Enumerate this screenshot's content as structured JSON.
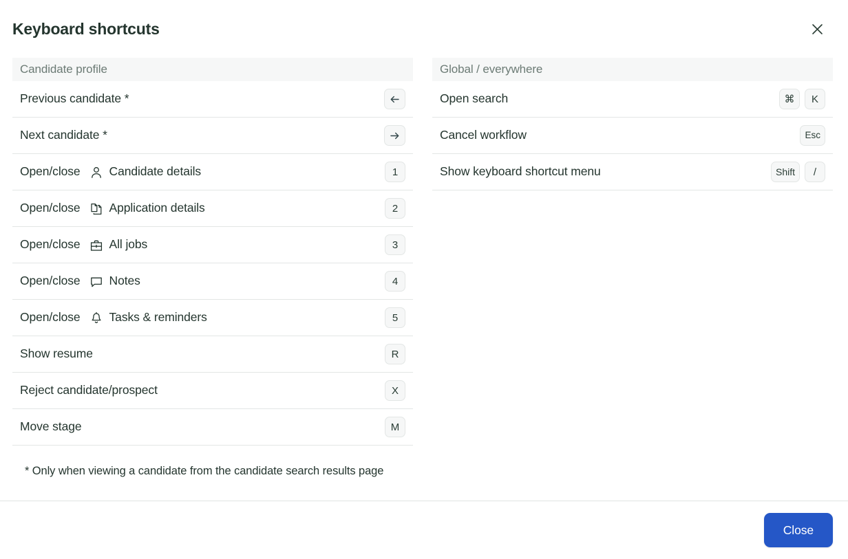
{
  "modal": {
    "title": "Keyboard shortcuts",
    "close_icon": "close-icon",
    "footnote": "* Only when viewing a candidate from the candidate search results page",
    "close_button_label": "Close",
    "accent_color": "#2557c7",
    "text_color": "#24352e",
    "muted_color": "#6c7b75",
    "section_bg": "#f6f7f7",
    "key_bg": "#f6f7f7",
    "key_border": "#e3e6e5",
    "divider_color": "#e3e6e5"
  },
  "columns": [
    {
      "heading": "Candidate profile",
      "rows": [
        {
          "prefix": "Previous candidate *",
          "icon": null,
          "suffix": null,
          "keys": [
            {
              "glyph": "arrow-left",
              "label": "←",
              "type": "icon"
            }
          ]
        },
        {
          "prefix": "Next candidate *",
          "icon": null,
          "suffix": null,
          "keys": [
            {
              "glyph": "arrow-right",
              "label": "→",
              "type": "icon"
            }
          ]
        },
        {
          "prefix": "Open/close",
          "icon": "person-icon",
          "suffix": "Candidate details",
          "keys": [
            {
              "label": "1",
              "type": "text"
            }
          ]
        },
        {
          "prefix": "Open/close",
          "icon": "copy-documents-icon",
          "suffix": "Application details",
          "keys": [
            {
              "label": "2",
              "type": "text"
            }
          ]
        },
        {
          "prefix": "Open/close",
          "icon": "briefcase-icon",
          "suffix": "All jobs",
          "keys": [
            {
              "label": "3",
              "type": "text"
            }
          ]
        },
        {
          "prefix": "Open/close",
          "icon": "speech-bubble-icon",
          "suffix": "Notes",
          "keys": [
            {
              "label": "4",
              "type": "text"
            }
          ]
        },
        {
          "prefix": "Open/close",
          "icon": "bell-icon",
          "suffix": "Tasks & reminders",
          "keys": [
            {
              "label": "5",
              "type": "text"
            }
          ]
        },
        {
          "prefix": "Show resume",
          "icon": null,
          "suffix": null,
          "keys": [
            {
              "label": "R",
              "type": "text"
            }
          ]
        },
        {
          "prefix": "Reject candidate/prospect",
          "icon": null,
          "suffix": null,
          "keys": [
            {
              "label": "X",
              "type": "text"
            }
          ]
        },
        {
          "prefix": "Move stage",
          "icon": null,
          "suffix": null,
          "keys": [
            {
              "label": "M",
              "type": "text"
            }
          ]
        }
      ]
    },
    {
      "heading": "Global / everywhere",
      "rows": [
        {
          "prefix": "Open search",
          "icon": null,
          "suffix": null,
          "keys": [
            {
              "label": "⌘",
              "type": "text"
            },
            {
              "label": "K",
              "type": "text"
            }
          ]
        },
        {
          "prefix": "Cancel workflow",
          "icon": null,
          "suffix": null,
          "keys": [
            {
              "label": "Esc",
              "type": "text",
              "size": "sm"
            }
          ]
        },
        {
          "prefix": "Show keyboard shortcut menu",
          "icon": null,
          "suffix": null,
          "keys": [
            {
              "label": "Shift",
              "type": "text",
              "size": "wide"
            },
            {
              "label": "/",
              "type": "text"
            }
          ]
        }
      ]
    }
  ]
}
